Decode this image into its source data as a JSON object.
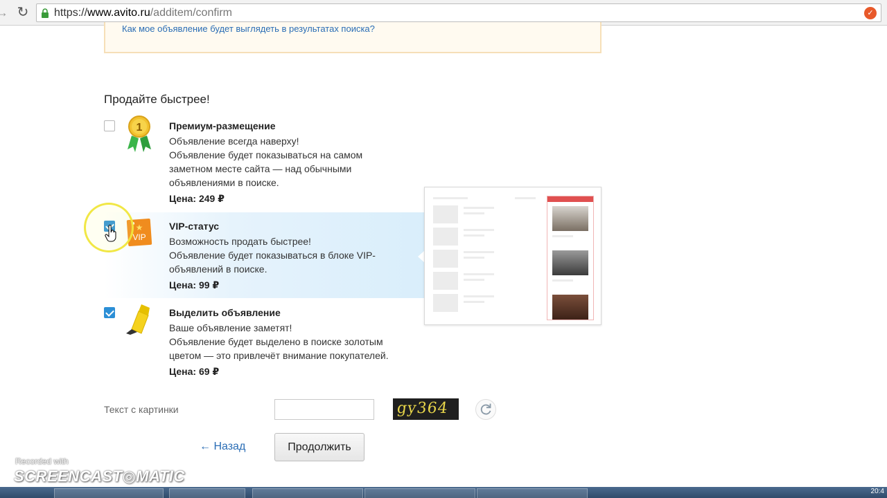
{
  "browser": {
    "url_scheme": "https://",
    "url_host": "www.avito.ru",
    "url_path": "/additem/confirm",
    "clock": "20:4"
  },
  "notice": {
    "link_text": "Как мое объявление будет выглядеть в результатах поиска?"
  },
  "section": {
    "title": "Продайте быстрее!"
  },
  "options": [
    {
      "title": "Премиум-размещение",
      "lines": [
        "Объявление всегда наверху!",
        "Объявление будет показываться на самом",
        "заметном месте сайта — над обычными",
        "объявлениями в поиске."
      ],
      "price": "Цена: 249 ₽",
      "checked": false,
      "icon_badge": "1"
    },
    {
      "title": "VIP-статус",
      "lines": [
        "Возможность продать быстрее!",
        "Объявление будет показываться в блоке VIP-",
        "объявлений в поиске."
      ],
      "price": "Цена: 99 ₽",
      "checked": true,
      "icon_badge": "VIP"
    },
    {
      "title": "Выделить объявление",
      "lines": [
        "Ваше объявление заметят!",
        "Объявление будет выделено в поиске золотым",
        "цветом — это привлечёт внимание покупателей."
      ],
      "price": "Цена: 69 ₽",
      "checked": true
    }
  ],
  "captcha": {
    "label": "Текст с картинки",
    "input_value": "",
    "image_text": "gy364"
  },
  "actions": {
    "back": "← Назад",
    "continue": "Продолжить"
  },
  "watermark": {
    "small": "Recorded with",
    "big": "SCREENCAST◎MATIC"
  },
  "colors": {
    "link": "#2a6db5",
    "checkbox": "#2c8fd6",
    "vip_highlight": "#d9eefb",
    "notice_bg": "#fffaf0"
  }
}
